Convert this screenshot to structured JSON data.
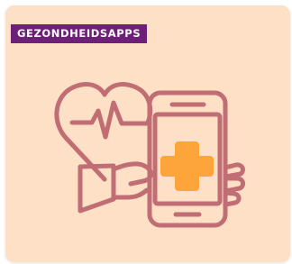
{
  "card": {
    "category_label": "GEZONDHEIDSAPPS",
    "icon": "health-app-phone-heart-icon"
  },
  "colors": {
    "card_background": "#fde0c6",
    "badge_background": "#6e1f78",
    "badge_text": "#ffffff",
    "icon_stroke": "#c06d73",
    "cross_fill": "#fda43a"
  }
}
